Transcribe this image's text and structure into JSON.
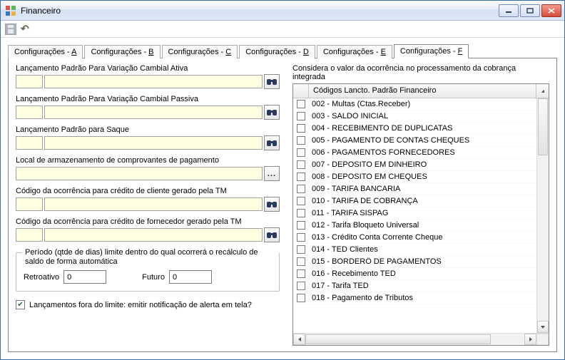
{
  "window": {
    "title": "Financeiro"
  },
  "toolbar": {
    "save_label": "",
    "undo_label": ""
  },
  "tabs": [
    {
      "text_prefix": "Configurações - ",
      "key": "A"
    },
    {
      "text_prefix": "Configurações - ",
      "key": "B"
    },
    {
      "text_prefix": "Configurações - ",
      "key": "C"
    },
    {
      "text_prefix": "Configurações - ",
      "key": "D"
    },
    {
      "text_prefix": "Configurações - ",
      "key": "E"
    },
    {
      "text_prefix": "Configurações - ",
      "key": "F"
    }
  ],
  "active_tab_index": 5,
  "left": {
    "f1_label": "Lançamento Padrão Para Variação Cambial Ativa",
    "f2_label": "Lançamento Padrão Para Variação Cambial Passiva",
    "f3_label": "Lançamento Padrão para Saque",
    "f4_label": "Local de armazenamento de comprovantes de pagamento",
    "f5_label": "Código da ocorrência para crédito de cliente gerado pela TM",
    "f6_label": "Código da ocorrência para crédito de fornecedor gerado pela TM",
    "group_legend": "Período (qtde de dias) limite dentro do qual ocorrerá o recálculo de saldo de forma automática",
    "retro_label": "Retroativo",
    "retro_value": "0",
    "futuro_label": "Futuro",
    "futuro_value": "0",
    "checkbox_label": "Lançamentos fora do limite: emitir notificação de alerta em tela?",
    "checkbox_checked": "✔"
  },
  "right": {
    "title": "Considera o valor da ocorrência no processamento da cobrança integrada",
    "column_header": "Códigos Lancto. Padrão Financeiro",
    "rows": [
      "002 - Multas (Ctas.Receber)",
      "003 - SALDO INICIAL",
      "004 - RECEBIMENTO DE DUPLICATAS",
      "005 - PAGAMENTO DE CONTAS CHEQUES",
      "006 - PAGAMENTOS FORNECEDORES",
      "007 - DEPOSITO EM DINHEIRO",
      "008 - DEPOSITO EM CHEQUES",
      "009 - TARIFA BANCARIA",
      "010 - TARIFA DE COBRANÇA",
      "011 - TARIFA SISPAG",
      "012 - Tarifa Bloqueto Universal",
      "013 - Crédito Conta Corrente Cheque",
      "014 - TED Clientes",
      "015 - BORDERÔ DE PAGAMENTOS",
      "016 - Recebimento TED",
      "017 - Tarifa TED",
      "018 - Pagamento de Tributos"
    ]
  }
}
